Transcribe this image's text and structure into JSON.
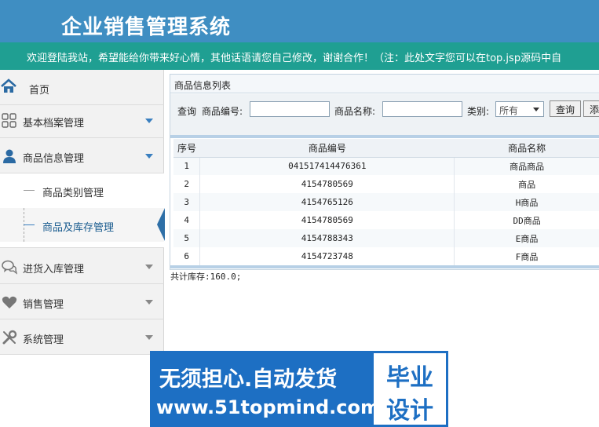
{
  "header": {
    "title": "企业销售管理系统",
    "marquee": "欢迎登陆我站，希望能给你带来好心情，其他话语请您自己修改，谢谢合作！（注：此处文字您可以在top.jsp源码中自"
  },
  "sidebar": {
    "home": "首页",
    "archive": "基本档案管理",
    "product_info": "商品信息管理",
    "sub_category": "商品类别管理",
    "sub_stock": "商品及库存管理",
    "purchase": "进货入库管理",
    "sales": "销售管理",
    "system": "系统管理"
  },
  "main": {
    "panel_title": "商品信息列表",
    "search": {
      "query_label": "查询",
      "code_label": "商品编号:",
      "code_value": "",
      "name_label": "商品名称:",
      "name_value": "",
      "type_label": "类别:",
      "type_selected": "所有",
      "query_button": "查询",
      "add_button": "添"
    },
    "columns": [
      "序号",
      "商品编号",
      "商品名称"
    ],
    "rows": [
      {
        "no": "1",
        "code": "041517414476361",
        "name": "商品商品"
      },
      {
        "no": "2",
        "code": "4154780569",
        "name": "商品"
      },
      {
        "no": "3",
        "code": "4154765126",
        "name": "H商品"
      },
      {
        "no": "4",
        "code": "4154780569",
        "name": "DD商品"
      },
      {
        "no": "5",
        "code": "4154788343",
        "name": "E商品"
      },
      {
        "no": "6",
        "code": "4154723748",
        "name": "F商品"
      }
    ],
    "total_stock": "共计库存:160.0;"
  },
  "ad": {
    "slogan": "无须担心.自动发货",
    "site": "www.51topmind.com",
    "logo_line1": "毕业",
    "logo_line2": "设计"
  },
  "colors": {
    "header_bg": "#3f8ec2",
    "marquee_bg": "#1f9f92",
    "accent": "#2e6fa7",
    "ad_bg": "#1d6fc3"
  },
  "icons": {
    "home": "home-icon",
    "archive": "grid-icon",
    "product_info": "user-icon",
    "purchase": "chat-icon",
    "sales": "heart-icon",
    "system": "wrench-icon"
  }
}
